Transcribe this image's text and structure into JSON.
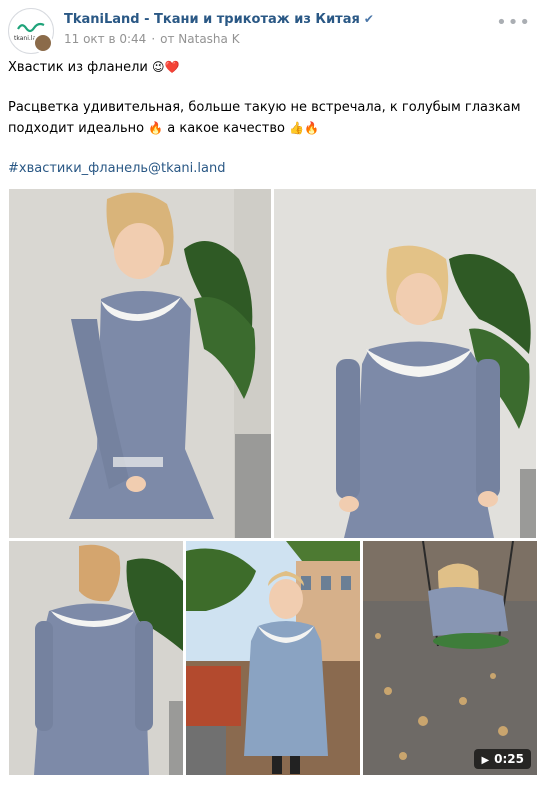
{
  "post": {
    "author": "TkaniLand - Ткани и трикотаж из Китая",
    "avatar_text": "tkani.la",
    "date": "11 окт в 0:44",
    "from": "от Natasha K",
    "more_icon": "more-dots-icon",
    "text_line1": "Хвастик из фланели",
    "text_line2": "Расцветка удивительная, больше такую не встречала, к голубым глазкам",
    "text_line3a": "подходит идеально",
    "text_line3b": "а какое качество",
    "hashtag": "#хвастики_фланель@tkani.land"
  },
  "media": {
    "video_duration": "0:25"
  },
  "colors": {
    "link": "#2a5885",
    "meta": "#939393",
    "dress": "#7d8aa8"
  }
}
